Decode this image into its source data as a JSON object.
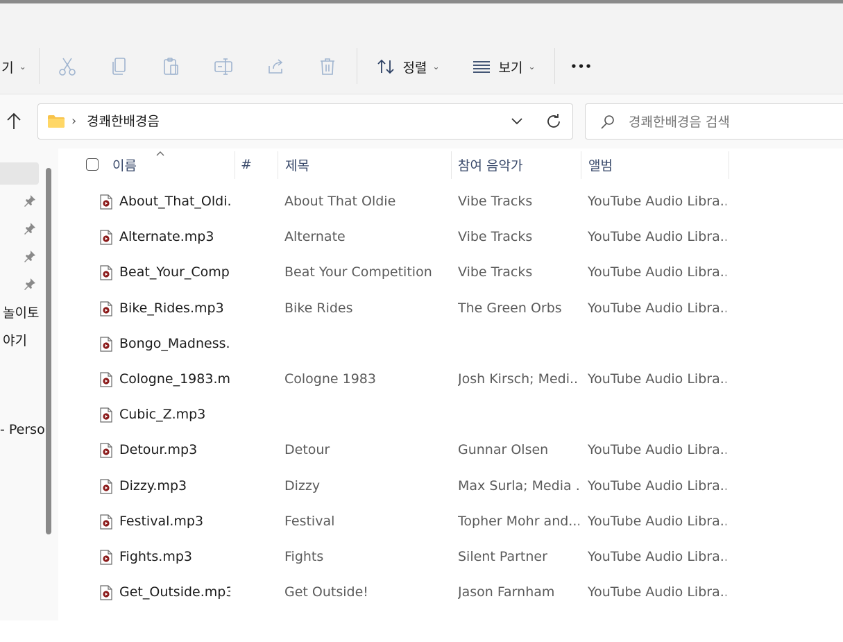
{
  "toolbar": {
    "new_partial": "기",
    "sort_label": "정렬",
    "view_label": "보기",
    "more_label": "•••"
  },
  "address": {
    "current_folder": "경쾌한배경음",
    "separator": "›"
  },
  "search": {
    "placeholder": "경쾌한배경음 검색"
  },
  "navpane": {
    "items": [
      "놀이토",
      "야기",
      "- Perso"
    ]
  },
  "columns": {
    "name": "이름",
    "number": "#",
    "title": "제목",
    "artist": "참여 음악가",
    "album": "앨범"
  },
  "files": [
    {
      "name": "About_That_Oldi...",
      "title": "About That Oldie",
      "artist": "Vibe Tracks",
      "album": "YouTube Audio Libra..."
    },
    {
      "name": "Alternate.mp3",
      "title": "Alternate",
      "artist": "Vibe Tracks",
      "album": "YouTube Audio Libra..."
    },
    {
      "name": "Beat_Your_Comp...",
      "title": "Beat Your Competition",
      "artist": "Vibe Tracks",
      "album": "YouTube Audio Libra..."
    },
    {
      "name": "Bike_Rides.mp3",
      "title": "Bike Rides",
      "artist": "The Green Orbs",
      "album": "YouTube Audio Libra..."
    },
    {
      "name": "Bongo_Madness....",
      "title": "",
      "artist": "",
      "album": ""
    },
    {
      "name": "Cologne_1983.m...",
      "title": "Cologne 1983",
      "artist": "Josh Kirsch; Medi...",
      "album": "YouTube Audio Libra..."
    },
    {
      "name": "Cubic_Z.mp3",
      "title": "",
      "artist": "",
      "album": ""
    },
    {
      "name": "Detour.mp3",
      "title": "Detour",
      "artist": "Gunnar Olsen",
      "album": "YouTube Audio Libra..."
    },
    {
      "name": "Dizzy.mp3",
      "title": "Dizzy",
      "artist": "Max Surla; Media ...",
      "album": "YouTube Audio Libra..."
    },
    {
      "name": "Festival.mp3",
      "title": "Festival",
      "artist": "Topher Mohr and...",
      "album": "YouTube Audio Libra..."
    },
    {
      "name": "Fights.mp3",
      "title": "Fights",
      "artist": "Silent Partner",
      "album": "YouTube Audio Libra..."
    },
    {
      "name": "Get_Outside.mp3",
      "title": "Get Outside!",
      "artist": "Jason Farnham",
      "album": "YouTube Audio Libra..."
    }
  ],
  "colors": {
    "accent": "#005fb8",
    "folder": "#f8c34a",
    "media_icon": "#8b1a1a",
    "header_text": "#3a4a6b"
  }
}
